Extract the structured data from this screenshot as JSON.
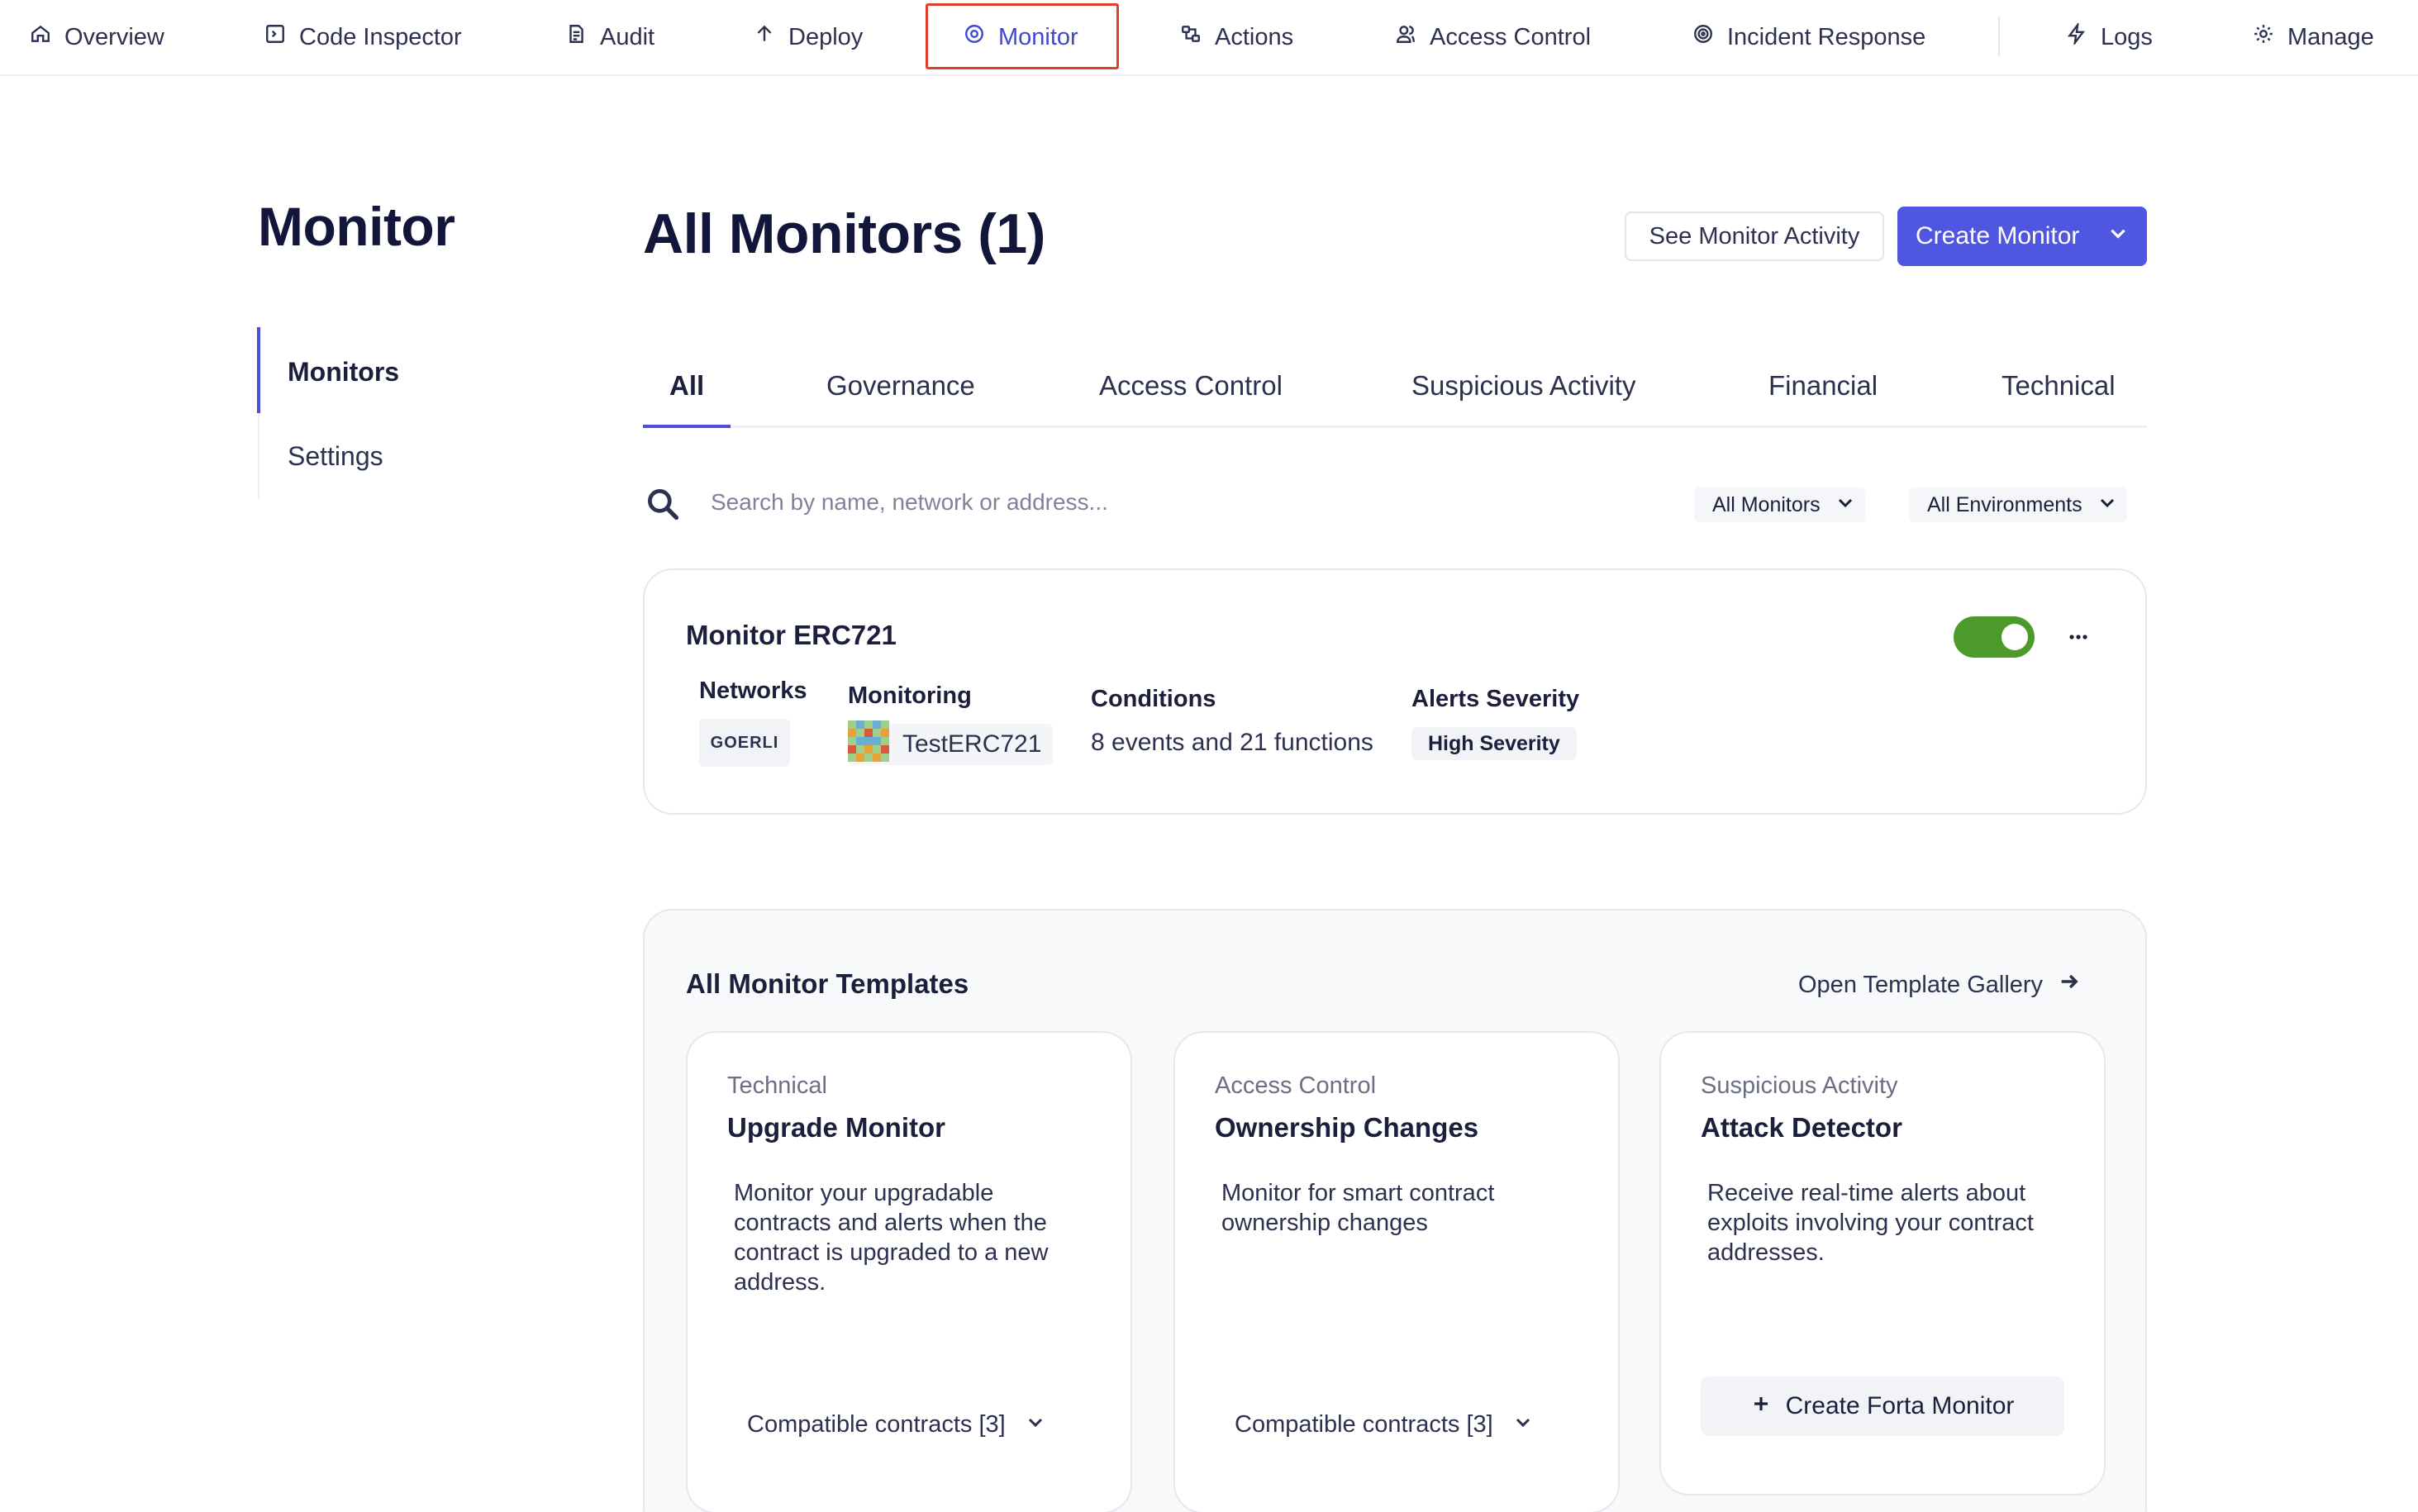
{
  "nav": {
    "items": [
      {
        "label": "Overview",
        "icon": "home-icon"
      },
      {
        "label": "Code Inspector",
        "icon": "code-icon"
      },
      {
        "label": "Audit",
        "icon": "audit-icon"
      },
      {
        "label": "Deploy",
        "icon": "arrow-up-icon"
      },
      {
        "label": "Monitor",
        "icon": "eye-icon",
        "active": true
      },
      {
        "label": "Actions",
        "icon": "actions-icon"
      },
      {
        "label": "Access Control",
        "icon": "users-icon"
      },
      {
        "label": "Incident Response",
        "icon": "target-icon"
      },
      {
        "label": "Logs",
        "icon": "bolt-icon"
      },
      {
        "label": "Manage",
        "icon": "gear-icon"
      }
    ]
  },
  "sidebar": {
    "title": "Monitor",
    "items": [
      {
        "label": "Monitors",
        "active": true
      },
      {
        "label": "Settings"
      }
    ]
  },
  "header": {
    "title": "All Monitors (1)",
    "activity_button": "See Monitor Activity",
    "create_button": "Create Monitor"
  },
  "tabs": [
    "All",
    "Governance",
    "Access Control",
    "Suspicious Activity",
    "Financial",
    "Technical"
  ],
  "search": {
    "placeholder": "Search by name, network or address...",
    "value": ""
  },
  "filters": {
    "type": "All Monitors",
    "environment": "All Environments"
  },
  "monitor": {
    "name": "Monitor ERC721",
    "enabled": true,
    "networks_label": "Networks",
    "network": "GOERLI",
    "monitoring_label": "Monitoring",
    "contract": "TestERC721",
    "conditions_label": "Conditions",
    "conditions": "8 events and 21 functions",
    "severity_label": "Alerts Severity",
    "severity": "High Severity"
  },
  "templates": {
    "heading": "All Monitor Templates",
    "gallery_link": "Open Template Gallery",
    "cards": [
      {
        "category": "Technical",
        "title": "Upgrade Monitor",
        "description": "Monitor your upgradable contracts and alerts when the contract is upgraded to a new address.",
        "compatible": "Compatible contracts [3]"
      },
      {
        "category": "Access Control",
        "title": "Ownership Changes",
        "description": "Monitor for smart contract ownership changes",
        "compatible": "Compatible contracts [3]"
      },
      {
        "category": "Suspicious Activity",
        "title": "Attack Detector",
        "description": "Receive real-time alerts about exploits involving your contract addresses.",
        "action": "Create Forta Monitor"
      }
    ]
  },
  "colors": {
    "accent": "#4f56e0",
    "active_nav_outline": "#e0402a",
    "toggle_on": "#4c9a2a"
  }
}
